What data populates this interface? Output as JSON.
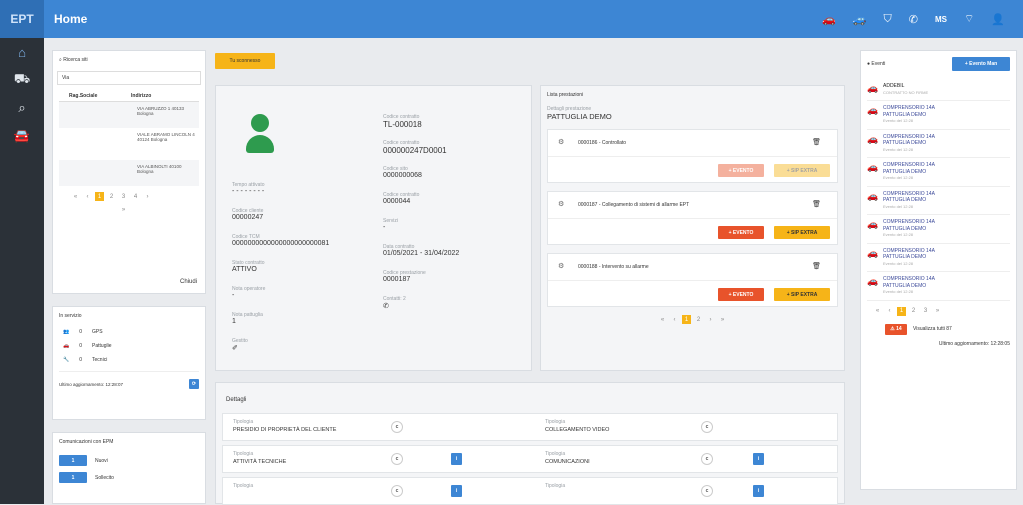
{
  "topbar": {
    "logo": "EPT",
    "title": "Home",
    "user": "MS"
  },
  "search": {
    "title": "Ricerca siti",
    "input": "Via",
    "col1": "Rag.Sociale",
    "col2": "Indirizzo",
    "rows": [
      "VIA ABRUZZO 1 40133 Bologna",
      "VIALE ABRAMO LINCOLN 4 40124 Bologna",
      "VIA ALBINOLTI 40100 Bologna"
    ],
    "pages": [
      "«",
      "‹",
      "1",
      "2",
      "3",
      "4",
      "›"
    ],
    "page2": "»",
    "close": "Chiudi"
  },
  "servizio": {
    "title": "In servizio",
    "rows": [
      {
        "n": "0",
        "label": "GPS"
      },
      {
        "n": "0",
        "label": "Pattuglie"
      },
      {
        "n": "0",
        "label": "Tecnici"
      }
    ],
    "update": "Ultimo aggiornamento: 12:28:07"
  },
  "comm": {
    "title": "Comunicazioni con EPM",
    "rows": [
      {
        "n": "1",
        "label": "Nuovi"
      },
      {
        "n": "1",
        "label": "Sollecito"
      }
    ]
  },
  "tag": "Tu sconnesso",
  "detail": {
    "c1": [
      {
        "l": "Tempo attivato",
        "v": "- - - - - - - -"
      },
      {
        "l": "Codice cliente",
        "v": "00000247"
      },
      {
        "l": "Codice TCM",
        "v": "0000000000000000000000081"
      },
      {
        "l": "Stato contratto",
        "v": "ATTIVO"
      },
      {
        "l": "Nota operatore",
        "v": "-"
      },
      {
        "l": "Nota pattuglia",
        "v": "1"
      },
      {
        "l": "Gestito",
        "v": "✐"
      }
    ],
    "c2": [
      {
        "l": "Codice contratto",
        "v": "TL-000018"
      },
      {
        "l": "Codice contratto",
        "v": "000000247D0001"
      },
      {
        "l": "Codice sito",
        "v": "0000000068"
      },
      {
        "l": "Codice contratto",
        "v": "0000044"
      },
      {
        "l": "Servizi",
        "v": "-"
      },
      {
        "l": "Data contratto",
        "v": "01/05/2021 - 31/04/2022"
      },
      {
        "l": "Codice prestazione",
        "v": "0000187"
      },
      {
        "l": "Contatti: 2",
        "v": "✆"
      }
    ]
  },
  "lista": {
    "title": "Lista prestazioni",
    "l": "Dettagli prestazione",
    "v": "PATTUGLIA DEMO",
    "items": [
      {
        "t": "0000186 - Controllato",
        "dim": true
      },
      {
        "t": "0000187 - Collegamento di sistemi di allarme EPT",
        "dim": false
      },
      {
        "t": "0000188 - Intervento su allarme",
        "dim": false
      }
    ],
    "evento": "+ EVENTO",
    "extra": "+ SIP EXTRA",
    "pages": [
      "«",
      "‹",
      "1",
      "2",
      "›",
      "»"
    ]
  },
  "dettagli": {
    "title": "Dettagli",
    "rows": [
      {
        "a": "PRESIDIO DI PROPRIETÀ DEL CLIENTE",
        "b": "COLLEGAMENTO VIDEO"
      },
      {
        "a": "ATTIVITÀ TECNICHE",
        "b": "COMUNICAZIONI"
      },
      {
        "a": "",
        "b": ""
      }
    ],
    "tl": "Tipologia"
  },
  "eventi": {
    "title": "Eventi",
    "btn": "+ Evento Man",
    "first": "ADDEBIL",
    "firstsub": "CONTRATTO NO FIRME",
    "item": "COMPRENSORIO 14A",
    "patt": "PATTUGLIA DEMO",
    "sub": "Evento del 12:28",
    "count": 7,
    "pages": [
      "«",
      "‹",
      "1",
      "2",
      "3",
      "»"
    ],
    "alert": "⚠ 14",
    "viz": "Visualizza tutti 87",
    "update": "Ultimo aggiornamento: 12:28:05"
  },
  "colors": {
    "blue": "#3d86d4",
    "red": "#e8532b",
    "yellow": "#f6b418",
    "green": "#2e9b4e"
  }
}
